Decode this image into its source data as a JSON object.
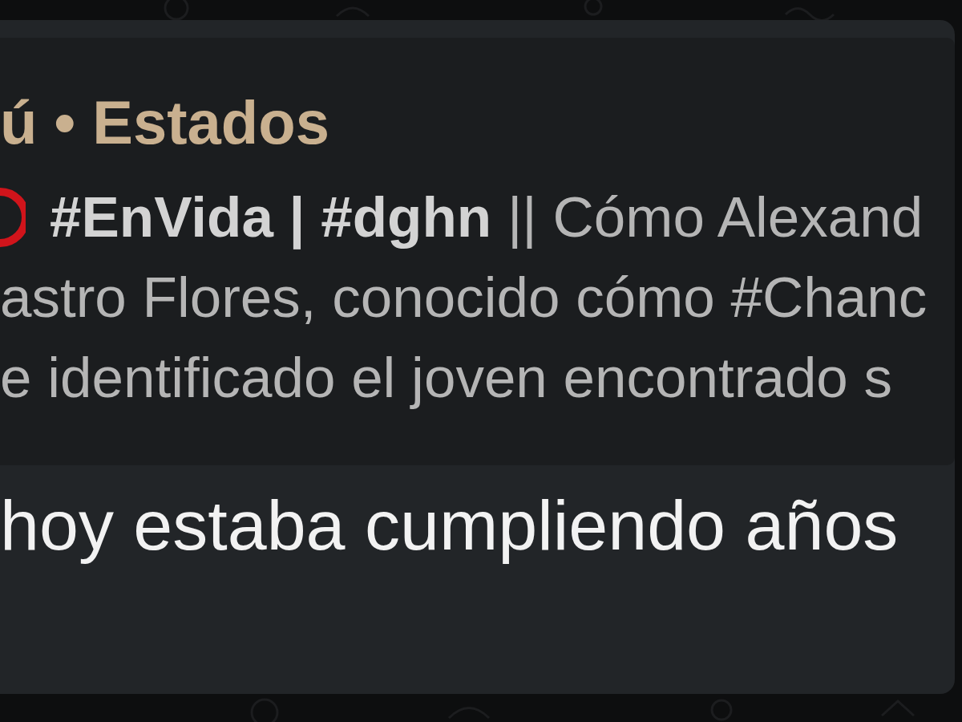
{
  "quote": {
    "author": "ú • Estados",
    "first_line": "**#EnVida | #dghn** ||  Cómo Alexand",
    "lines": [
      "astro Flores, conocido cómo #Chanc",
      "e identificado el joven encontrado s"
    ]
  },
  "message": {
    "text": "hoy estaba cumpliendo años"
  }
}
